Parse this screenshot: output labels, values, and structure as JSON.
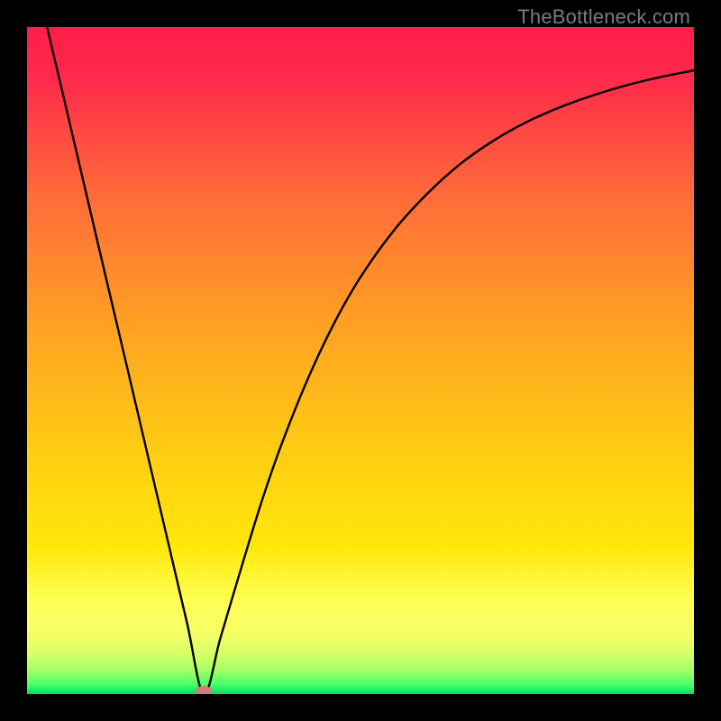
{
  "watermark": "TheBottleneck.com",
  "chart_data": {
    "type": "line",
    "title": "",
    "xlabel": "",
    "ylabel": "",
    "xlim": [
      0,
      1
    ],
    "ylim": [
      0,
      1
    ],
    "background_gradient": {
      "top_color": "#ff1d49",
      "mid_color": "#ffd400",
      "bottom_band_color": "#ffff66",
      "bottom_edge_color": "#00e065"
    },
    "minimum_marker": {
      "x": 0.265,
      "y": 0.0,
      "color": "#d97a7a"
    },
    "series": [
      {
        "name": "bottleneck-curve",
        "color": "#000000",
        "x": [
          0.03,
          0.06,
          0.09,
          0.12,
          0.15,
          0.18,
          0.21,
          0.24,
          0.265,
          0.29,
          0.32,
          0.35,
          0.38,
          0.42,
          0.46,
          0.5,
          0.55,
          0.6,
          0.65,
          0.7,
          0.75,
          0.8,
          0.85,
          0.9,
          0.95,
          1.0
        ],
        "y": [
          1.0,
          0.873,
          0.745,
          0.617,
          0.49,
          0.362,
          0.234,
          0.106,
          0.0,
          0.084,
          0.185,
          0.283,
          0.37,
          0.47,
          0.555,
          0.625,
          0.695,
          0.75,
          0.795,
          0.83,
          0.858,
          0.88,
          0.898,
          0.913,
          0.925,
          0.935
        ]
      }
    ]
  }
}
